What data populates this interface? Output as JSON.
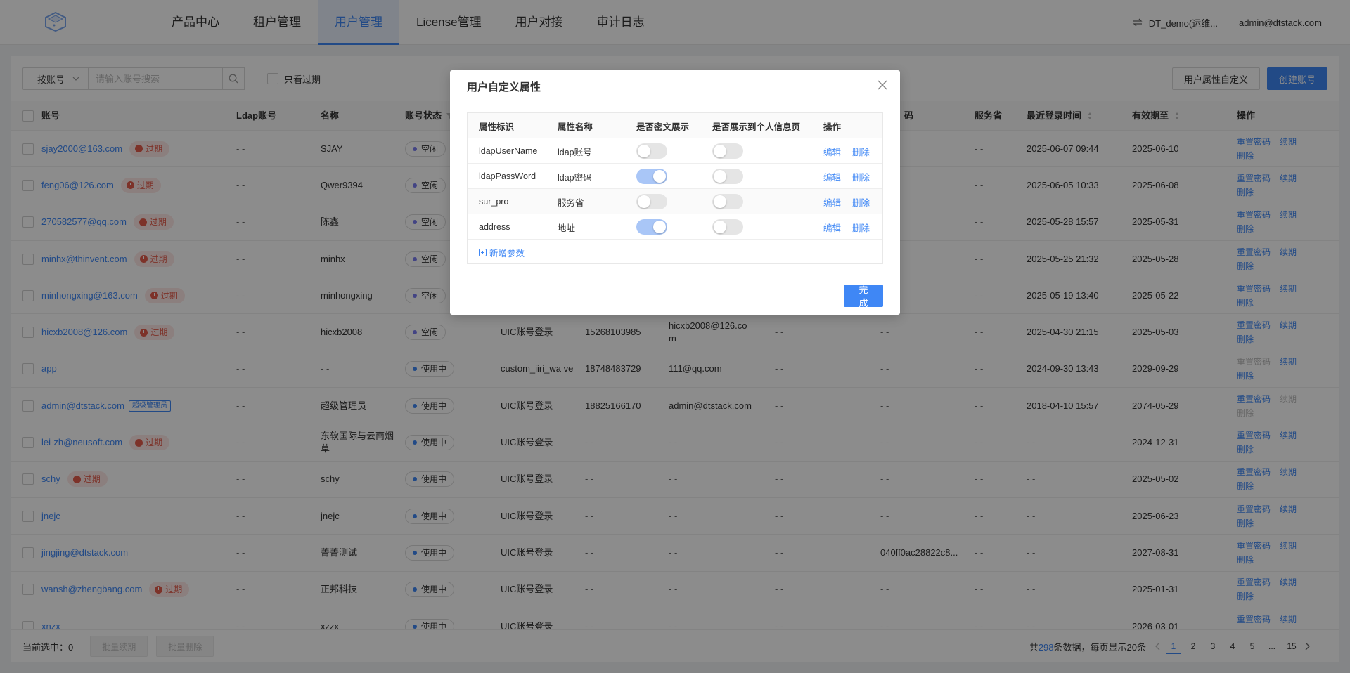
{
  "header": {
    "nav": [
      "产品中心",
      "租户管理",
      "用户管理",
      "License管理",
      "用户对接",
      "审计日志"
    ],
    "active_index": 2,
    "tenant": "DT_demo(运维...",
    "user": "admin@dtstack.com"
  },
  "toolbar": {
    "select_value": "按账号",
    "search_placeholder": "请输入账号搜索",
    "expired_only_label": "只看过期",
    "custom_attr_button": "用户属性自定义",
    "create_button": "创建账号"
  },
  "table": {
    "headers": [
      "账号",
      "Ldap账号",
      "名称",
      "账号状态",
      "",
      "",
      "",
      "",
      "",
      "服务省",
      "最近登录时间",
      "有效期至",
      "操作"
    ],
    "header_hidden_fragment": "码",
    "expired_tag": "过期",
    "admin_tag": "超级管理员",
    "ops": {
      "reset": "重置密码",
      "renew": "续期",
      "delete": "删除"
    },
    "rows": [
      {
        "account": "sjay2000@163.com",
        "tag": "expired",
        "ldap": "- -",
        "name": "SJAY",
        "status": "空闲",
        "login_type": "",
        "phone": "",
        "email": "",
        "c7": "",
        "c8": "",
        "province": "- -",
        "last_login": "2025-06-07 09:44",
        "expire": "2025-06-10",
        "reset_disabled": false,
        "renew_disabled": false,
        "delete_disabled": false
      },
      {
        "account": "feng06@126.com",
        "tag": "expired",
        "ldap": "- -",
        "name": "Qwer9394",
        "status": "空闲",
        "login_type": "",
        "phone": "",
        "email": "",
        "c7": "",
        "c8": "",
        "province": "- -",
        "last_login": "2025-06-05 10:33",
        "expire": "2025-06-08",
        "reset_disabled": false,
        "renew_disabled": false,
        "delete_disabled": false
      },
      {
        "account": "270582577@qq.com",
        "tag": "expired",
        "ldap": "- -",
        "name": "陈鑫",
        "status": "空闲",
        "login_type": "",
        "phone": "",
        "email": "",
        "c7": "",
        "c8": "",
        "province": "- -",
        "last_login": "2025-05-28 15:57",
        "expire": "2025-05-31",
        "reset_disabled": false,
        "renew_disabled": false,
        "delete_disabled": false
      },
      {
        "account": "minhx@thinvent.com",
        "tag": "expired",
        "ldap": "- -",
        "name": "minhx",
        "status": "空闲",
        "login_type": "",
        "phone": "",
        "email": "",
        "c7": "",
        "c8": "",
        "province": "- -",
        "last_login": "2025-05-25 21:32",
        "expire": "2025-05-28",
        "reset_disabled": false,
        "renew_disabled": false,
        "delete_disabled": false
      },
      {
        "account": "minhongxing@163.com",
        "tag": "expired",
        "ldap": "- -",
        "name": "minhongxing",
        "status": "空闲",
        "login_type": "",
        "phone": "",
        "email": "",
        "c7": "",
        "c8": "",
        "province": "- -",
        "last_login": "2025-05-19 13:40",
        "expire": "2025-05-22",
        "reset_disabled": false,
        "renew_disabled": false,
        "delete_disabled": false
      },
      {
        "account": "hicxb2008@126.com",
        "tag": "expired",
        "ldap": "- -",
        "name": "hicxb2008",
        "status": "空闲",
        "login_type": "UIC账号登录",
        "phone": "15268103985",
        "email": "hicxb2008@126.co m",
        "c7": "- -",
        "c8": "- -",
        "province": "- -",
        "last_login": "2025-04-30 21:15",
        "expire": "2025-05-03",
        "reset_disabled": false,
        "renew_disabled": false,
        "delete_disabled": false
      },
      {
        "account": "app",
        "tag": "",
        "ldap": "- -",
        "name": "- -",
        "status": "使用中",
        "login_type": "custom_iiri_wa ve",
        "phone": "18748483729",
        "email": "111@qq.com",
        "c7": "- -",
        "c8": "- -",
        "province": "- -",
        "last_login": "2024-09-30 13:43",
        "expire": "2029-09-29",
        "reset_disabled": true,
        "renew_disabled": false,
        "delete_disabled": false
      },
      {
        "account": "admin@dtstack.com",
        "tag": "admin",
        "ldap": "- -",
        "name": "超级管理员",
        "status": "使用中",
        "login_type": "UIC账号登录",
        "phone": "18825166170",
        "email": "admin@dtstack.com",
        "c7": "- -",
        "c8": "- -",
        "province": "- -",
        "last_login": "2018-04-10 15:57",
        "expire": "2074-05-29",
        "reset_disabled": false,
        "renew_disabled": true,
        "delete_disabled": true
      },
      {
        "account": "lei-zh@neusoft.com",
        "tag": "expired",
        "ldap": "- -",
        "name": "东软国际与云南烟草",
        "status": "使用中",
        "login_type": "UIC账号登录",
        "phone": "- -",
        "email": "- -",
        "c7": "- -",
        "c8": "- -",
        "province": "- -",
        "last_login": "- -",
        "expire": "2024-12-31",
        "reset_disabled": false,
        "renew_disabled": false,
        "delete_disabled": false
      },
      {
        "account": "schy",
        "tag": "expired",
        "ldap": "- -",
        "name": "schy",
        "status": "使用中",
        "login_type": "UIC账号登录",
        "phone": "- -",
        "email": "- -",
        "c7": "- -",
        "c8": "- -",
        "province": "- -",
        "last_login": "- -",
        "expire": "2025-05-02",
        "reset_disabled": false,
        "renew_disabled": false,
        "delete_disabled": false
      },
      {
        "account": "jnejc",
        "tag": "",
        "ldap": "- -",
        "name": "jnejc",
        "status": "使用中",
        "login_type": "UIC账号登录",
        "phone": "- -",
        "email": "- -",
        "c7": "- -",
        "c8": "- -",
        "province": "- -",
        "last_login": "- -",
        "expire": "2025-06-23",
        "reset_disabled": false,
        "renew_disabled": false,
        "delete_disabled": false
      },
      {
        "account": "jingjing@dtstack.com",
        "tag": "",
        "ldap": "- -",
        "name": "菁菁测试",
        "status": "使用中",
        "login_type": "UIC账号登录",
        "phone": "- -",
        "email": "- -",
        "c7": "- -",
        "c8": "040ff0ac28822c8...",
        "province": "- -",
        "last_login": "- -",
        "expire": "2027-08-31",
        "reset_disabled": false,
        "renew_disabled": false,
        "delete_disabled": false
      },
      {
        "account": "wansh@zhengbang.com",
        "tag": "expired",
        "ldap": "- -",
        "name": "正邦科技",
        "status": "使用中",
        "login_type": "UIC账号登录",
        "phone": "- -",
        "email": "- -",
        "c7": "- -",
        "c8": "- -",
        "province": "- -",
        "last_login": "- -",
        "expire": "2025-01-31",
        "reset_disabled": false,
        "renew_disabled": false,
        "delete_disabled": false
      },
      {
        "account": "xnzx",
        "tag": "",
        "ldap": "- -",
        "name": "xzzx",
        "status": "使用中",
        "login_type": "UIC账号登录",
        "phone": "- -",
        "email": "- -",
        "c7": "- -",
        "c8": "- -",
        "province": "- -",
        "last_login": "- -",
        "expire": "2026-03-01",
        "reset_disabled": false,
        "renew_disabled": false,
        "delete_disabled": false
      }
    ]
  },
  "footer": {
    "selected_label": "当前选中：0",
    "batch_renew": "批量续期",
    "batch_delete": "批量删除",
    "total_prefix": "共",
    "total": "298",
    "total_suffix": "条数据，每页显示20条",
    "pages": [
      "1",
      "2",
      "3",
      "4",
      "5",
      "...",
      "15"
    ],
    "current_page": "1"
  },
  "modal": {
    "title": "用户自定义属性",
    "headers": [
      "属性标识",
      "属性名称",
      "是否密文展示",
      "是否展示到个人信息页",
      "操作"
    ],
    "edit": "编辑",
    "delete": "删除",
    "rows": [
      {
        "key": "ldapUserName",
        "name": "ldap账号",
        "cipher": false,
        "profile": false
      },
      {
        "key": "ldapPassWord",
        "name": "ldap密码",
        "cipher": true,
        "profile": false
      },
      {
        "key": "sur_pro",
        "name": "服务省",
        "cipher": false,
        "profile": false
      },
      {
        "key": "address",
        "name": "地址",
        "cipher": true,
        "profile": false
      }
    ],
    "add_param": "新增参数",
    "ok_button": "完成"
  }
}
